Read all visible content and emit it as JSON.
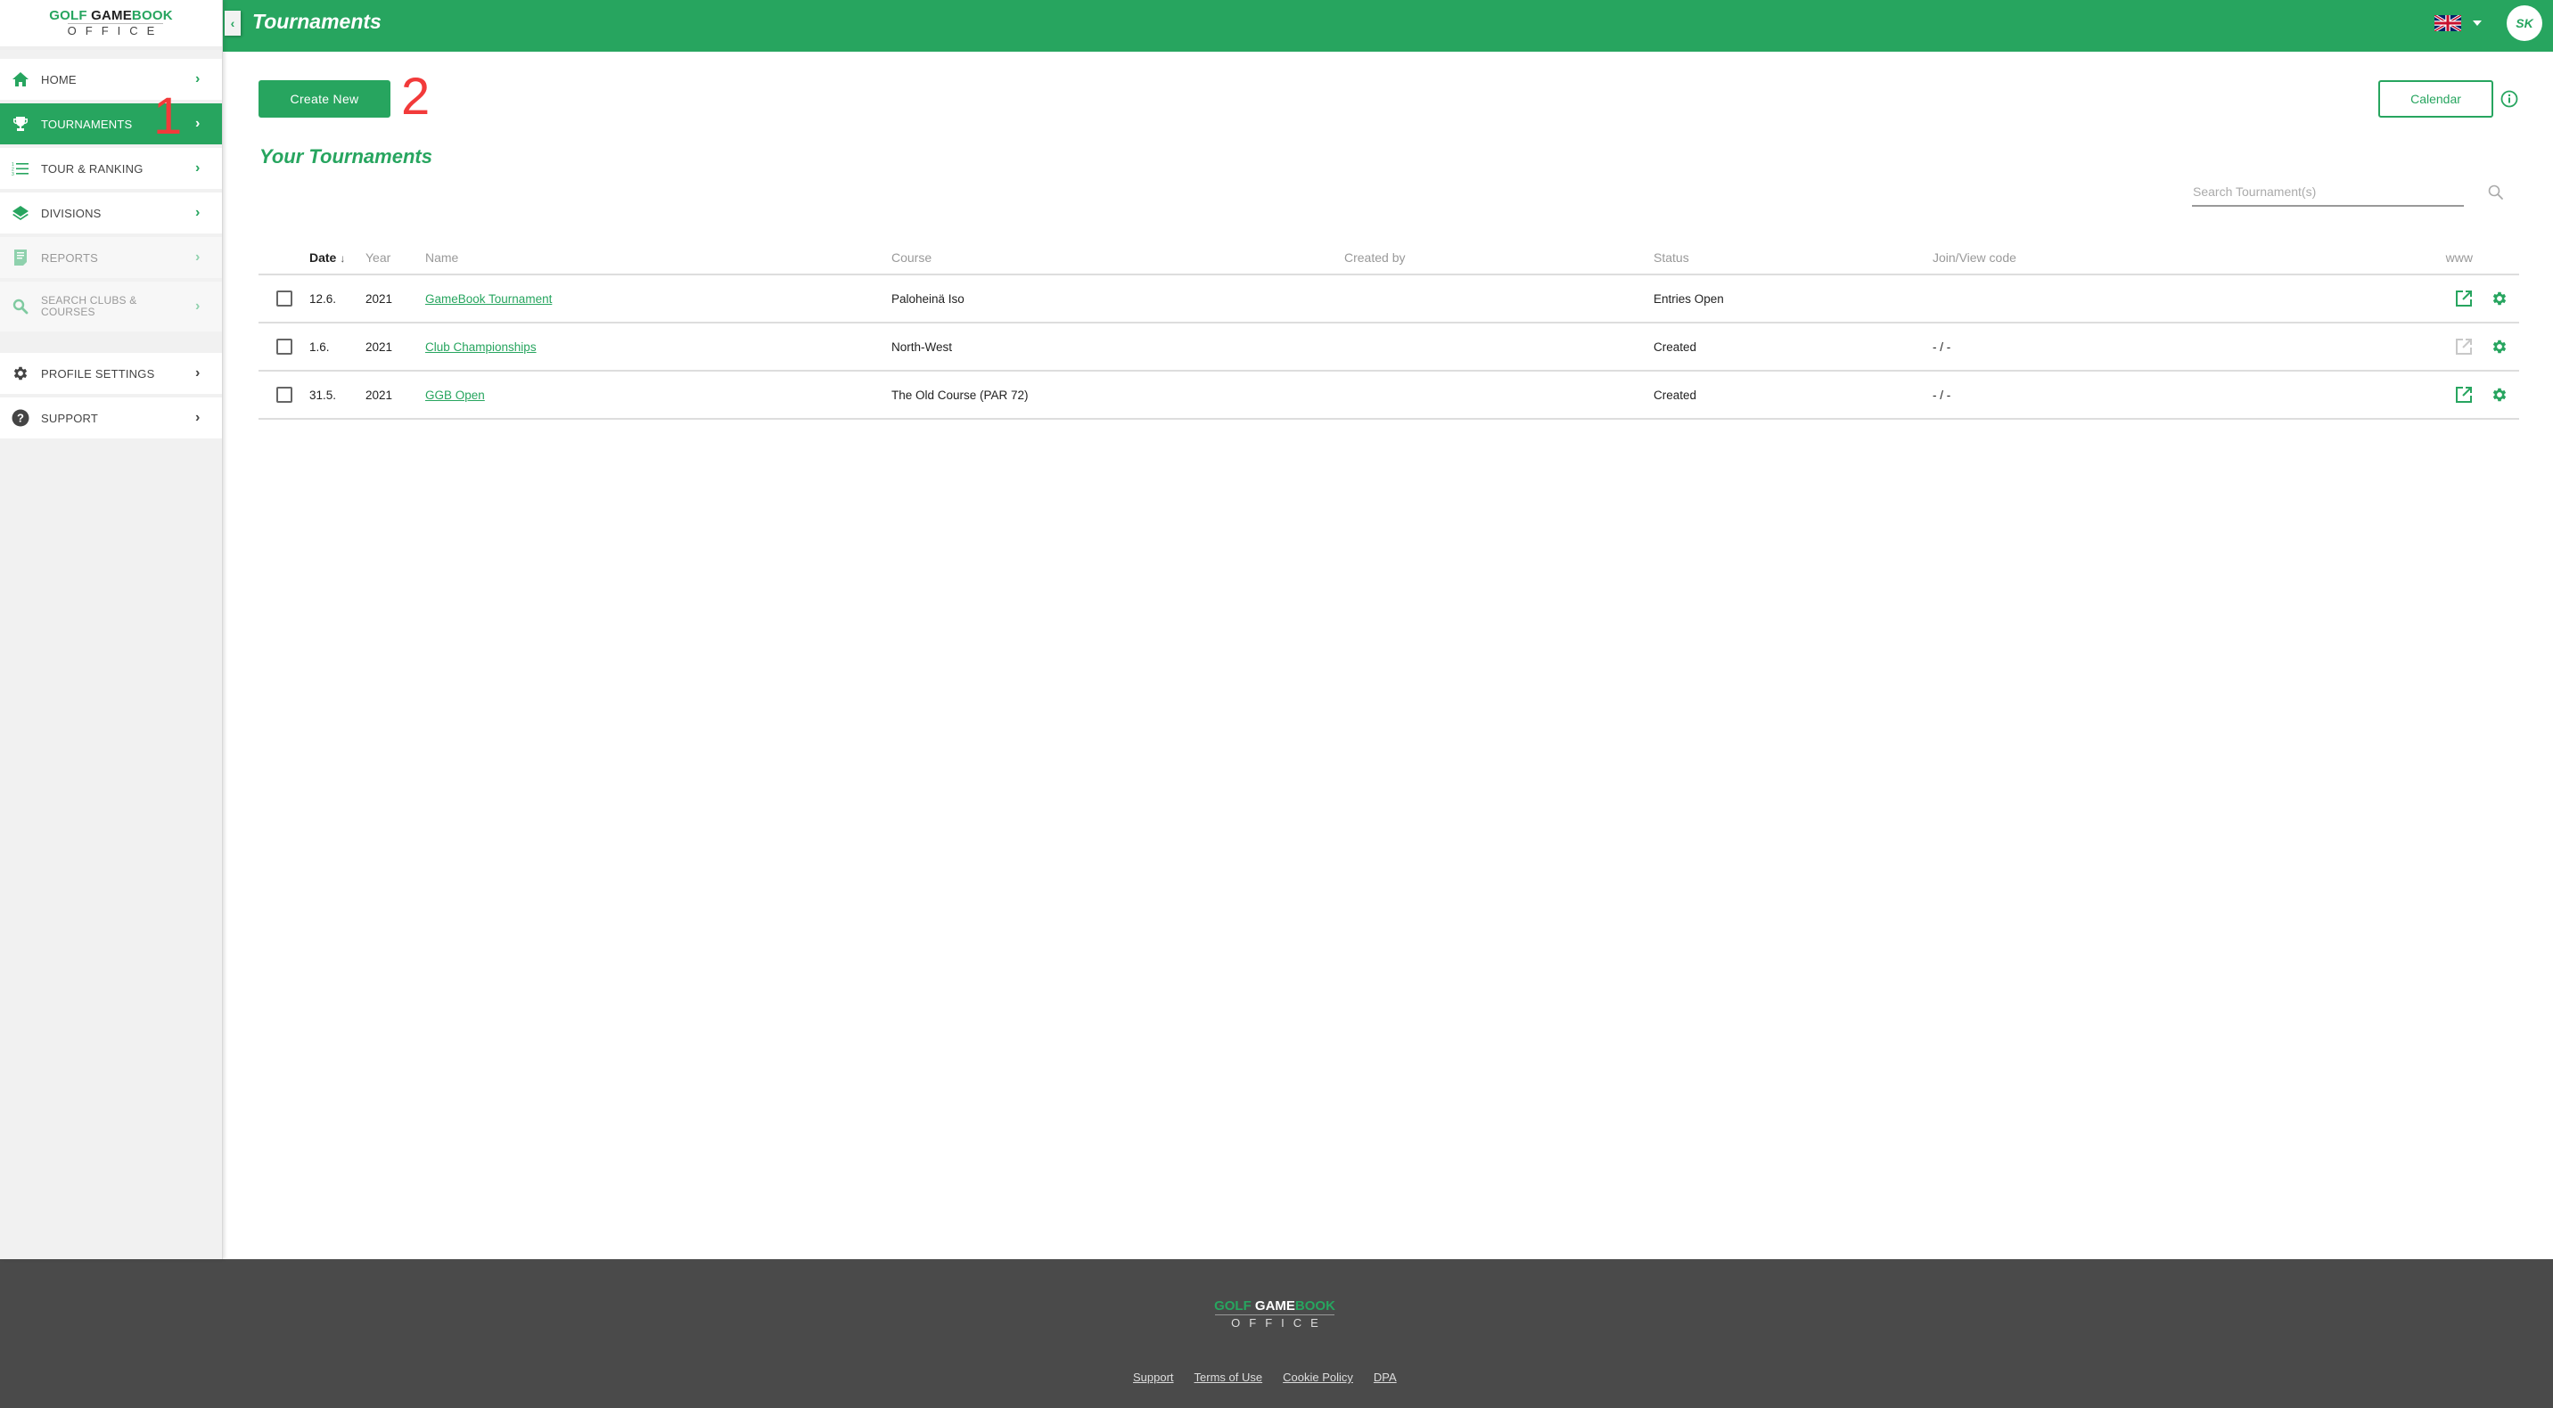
{
  "logo": {
    "brand_green": "GOLF",
    "brand_dark": "GAME",
    "brand_green2": "BOOK",
    "sub": "OFFICE"
  },
  "sidebar": {
    "items": [
      {
        "label": "HOME",
        "icon": "home-icon"
      },
      {
        "label": "TOURNAMENTS",
        "icon": "trophy-icon",
        "active": true
      },
      {
        "label": "TOUR & RANKING",
        "icon": "numbered-list-icon"
      },
      {
        "label": "DIVISIONS",
        "icon": "layers-icon"
      },
      {
        "label": "REPORTS",
        "icon": "report-icon",
        "disabled": true
      },
      {
        "label": "SEARCH CLUBS & COURSES",
        "icon": "search-icon",
        "disabled": true
      },
      {
        "label": "PROFILE SETTINGS",
        "icon": "gear-icon"
      },
      {
        "label": "SUPPORT",
        "icon": "help-icon"
      }
    ],
    "annotation": "1"
  },
  "header": {
    "title": "Tournaments",
    "language": "English (UK)",
    "avatar_initials": "SK"
  },
  "main": {
    "create_label": "Create New",
    "create_annotation": "2",
    "calendar_label": "Calendar",
    "section_title": "Your Tournaments",
    "search_placeholder": "Search Tournament(s)",
    "search_value": ""
  },
  "table": {
    "columns": {
      "date": "Date",
      "sort_indicator": "↓",
      "year": "Year",
      "name": "Name",
      "course": "Course",
      "created_by": "Created by",
      "status": "Status",
      "code": "Join/View code",
      "www": "www"
    },
    "rows": [
      {
        "date": "12.6.",
        "year": "2021",
        "name": "GameBook Tournament",
        "course": "Paloheinä Iso",
        "created_by": "",
        "status": "Entries Open",
        "code": "",
        "www_enabled": true
      },
      {
        "date": "1.6.",
        "year": "2021",
        "name": "Club Championships",
        "course": "North-West",
        "created_by": "",
        "status": "Created",
        "code": "- / -",
        "www_enabled": false
      },
      {
        "date": "31.5.",
        "year": "2021",
        "name": "GGB Open",
        "course": "The Old Course (PAR 72)",
        "created_by": "",
        "status": "Created",
        "code": "- / -",
        "www_enabled": true
      }
    ]
  },
  "footer": {
    "logo_brand_green": "GOLF",
    "logo_brand_white": "GAME",
    "logo_brand_green2": "BOOK",
    "logo_sub": "OFFICE",
    "links": [
      "Support",
      "Terms of Use",
      "Cookie Policy",
      "DPA"
    ]
  },
  "colors": {
    "accent": "#27a55f",
    "footer_bg": "#4a4a4a",
    "annotation": "#f23a3a",
    "disabled_icon": "#c8c8c8"
  }
}
